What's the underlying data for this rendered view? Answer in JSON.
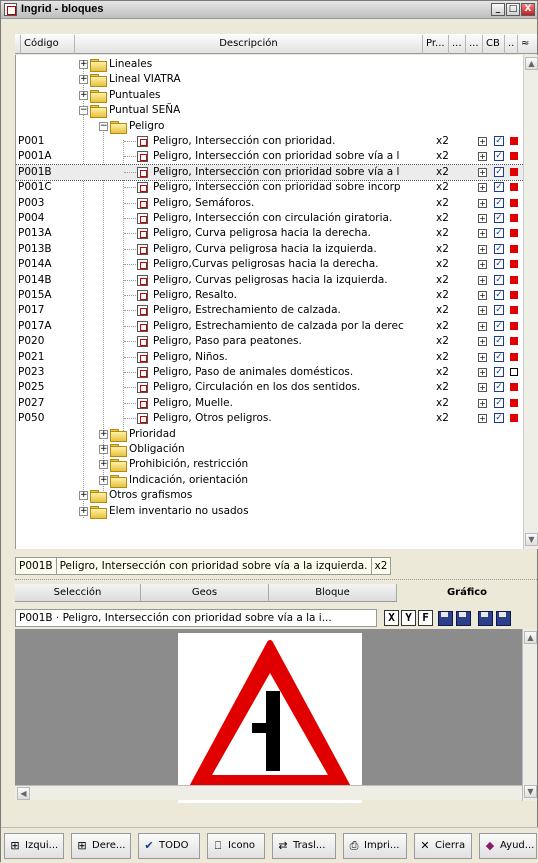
{
  "window": {
    "title": "Ingrid - bloques",
    "controls": [
      "_",
      "□",
      "X"
    ]
  },
  "columns": {
    "codigo": "Código",
    "descripcion": "Descripción",
    "pr": "Pr...",
    "dots1": "...",
    "dots2": "...",
    "cb": "CB",
    "dots3": "..",
    "last": "≈"
  },
  "tree": {
    "groups_top": [
      {
        "label": "Lineales"
      },
      {
        "label": "Lineal VIATRA"
      },
      {
        "label": "Puntuales"
      },
      {
        "label": "Puntual SEÑA"
      }
    ],
    "subgroup": "Peligro",
    "items": [
      {
        "code": "P001",
        "desc": "Peligro, Intersección con prioridad.",
        "mult": "x2",
        "red": true
      },
      {
        "code": "P001A",
        "desc": "Peligro, Intersección con prioridad sobre vía a l",
        "mult": "x2",
        "red": true
      },
      {
        "code": "P001B",
        "desc": "Peligro, Intersección con prioridad sobre vía a l",
        "mult": "x2",
        "red": true,
        "selected": true
      },
      {
        "code": "P001C",
        "desc": "Peligro, Intersección con prioridad sobre incorp",
        "mult": "x2",
        "red": true
      },
      {
        "code": "P003",
        "desc": "Peligro, Semáforos.",
        "mult": "x2",
        "red": true
      },
      {
        "code": "P004",
        "desc": "Peligro, Intersección con circulación giratoria.",
        "mult": "x2",
        "red": true
      },
      {
        "code": "P013A",
        "desc": "Peligro, Curva peligrosa hacia la derecha.",
        "mult": "x2",
        "red": true
      },
      {
        "code": "P013B",
        "desc": "Peligro, Curva peligrosa hacia la izquierda.",
        "mult": "x2",
        "red": true
      },
      {
        "code": "P014A",
        "desc": "Peligro,Curvas peligrosas hacia la derecha.",
        "mult": "x2",
        "red": true
      },
      {
        "code": "P014B",
        "desc": "Peligro, Curvas peligrosas hacia la izquierda.",
        "mult": "x2",
        "red": true
      },
      {
        "code": "P015A",
        "desc": "Peligro, Resalto.",
        "mult": "x2",
        "red": true
      },
      {
        "code": "P017",
        "desc": "Peligro, Estrechamiento de calzada.",
        "mult": "x2",
        "red": true
      },
      {
        "code": "P017A",
        "desc": "Peligro, Estrechamiento de calzada por la derec",
        "mult": "x2",
        "red": true
      },
      {
        "code": "P020",
        "desc": "Peligro, Paso para peatones.",
        "mult": "x2",
        "red": true
      },
      {
        "code": "P021",
        "desc": "Peligro, Niños.",
        "mult": "x2",
        "red": true
      },
      {
        "code": "P023",
        "desc": "Peligro, Paso de animales domésticos.",
        "mult": "x2",
        "red": false
      },
      {
        "code": "P025",
        "desc": "Peligro, Circulación en los dos sentidos.",
        "mult": "x2",
        "red": true
      },
      {
        "code": "P027",
        "desc": "Peligro, Muelle.",
        "mult": "x2",
        "red": true
      },
      {
        "code": "P050",
        "desc": "Peligro, Otros peligros.",
        "mult": "x2",
        "red": true
      }
    ],
    "subgroups_after": [
      {
        "label": "Prioridad"
      },
      {
        "label": "Obligación"
      },
      {
        "label": "Prohibición, restricción"
      },
      {
        "label": "Indicación, orientación"
      }
    ],
    "groups_bottom": [
      {
        "label": "Otros grafismos"
      },
      {
        "label": "Elem inventario no usados"
      }
    ]
  },
  "status": {
    "code": "P001B",
    "desc": "Peligro, Intersección con prioridad sobre vía a la izquierda.",
    "mult": "x2"
  },
  "tabs": [
    {
      "label": "Selección"
    },
    {
      "label": "Geos"
    },
    {
      "label": "Bloque"
    },
    {
      "label": "Gráfico",
      "active": true
    }
  ],
  "preview": {
    "path": "P001B · Peligro, Intersección con prioridad sobre vía a la i...",
    "buttons": [
      "X",
      "Y",
      "F"
    ]
  },
  "bottom_buttons": [
    {
      "label": "Izqui...",
      "icon": "left-panel-icon"
    },
    {
      "label": "Dere...",
      "icon": "right-panel-icon"
    },
    {
      "label": "TODO",
      "icon": "check-icon"
    },
    {
      "label": "Icono",
      "icon": "icon-view-icon"
    },
    {
      "label": "Trasl...",
      "icon": "transfer-icon"
    },
    {
      "label": "Impri...",
      "icon": "printer-icon"
    },
    {
      "label": "Cierra",
      "icon": "close-icon"
    },
    {
      "label": "Ayud...",
      "icon": "help-icon"
    }
  ],
  "colors": {
    "sign_red": "#e00000",
    "check_blue": "#1b3b8e",
    "selected_row": "#ececec"
  }
}
